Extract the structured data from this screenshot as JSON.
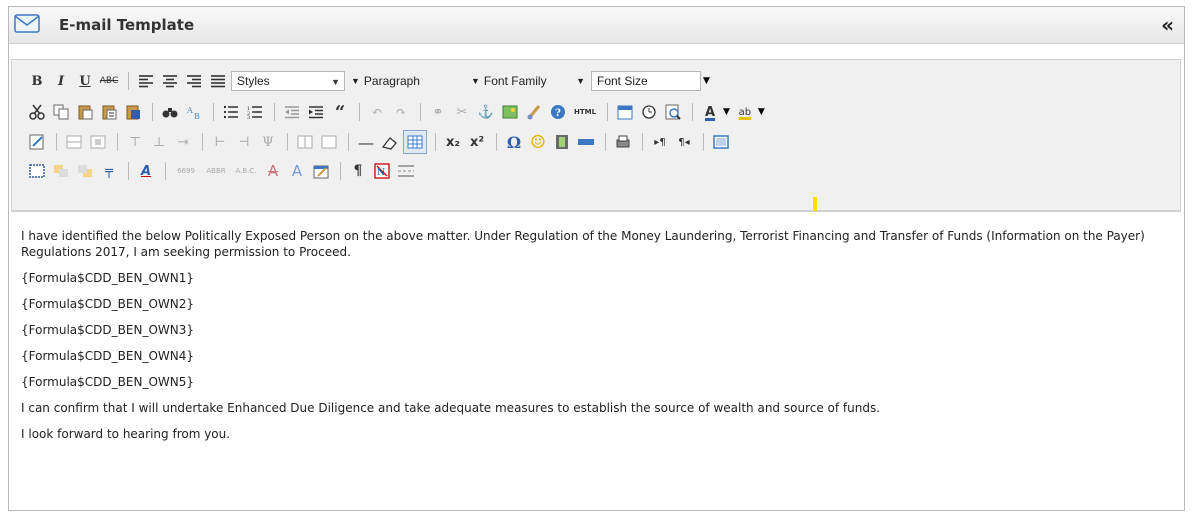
{
  "window": {
    "title": "E-mail Template",
    "collapse_label": "«"
  },
  "toolbar": {
    "styles_select": "Styles",
    "format_select": "Paragraph",
    "font_family_select": "Font Family",
    "font_size_select": "Font Size",
    "bold": "B",
    "italic": "I",
    "underline": "U",
    "strikethrough": "ABC",
    "subscript": "x₂",
    "superscript": "x²",
    "omega": "Ω",
    "paragraph_mark": "¶",
    "html_label": "HTML",
    "cite_label": "6699",
    "abbr_label": "ABBR",
    "acronym_label": "A.B.C."
  },
  "content": {
    "paragraphs": [
      "I have identified the below Politically Exposed Person on the above matter. Under Regulation of the Money Laundering, Terrorist Financing and Transfer of Funds (Information on the Payer) Regulations 2017, I am seeking permission to Proceed.",
      "{Formula$CDD_BEN_OWN1}",
      "{Formula$CDD_BEN_OWN2}",
      "{Formula$CDD_BEN_OWN3}",
      "{Formula$CDD_BEN_OWN4}",
      "{Formula$CDD_BEN_OWN5}",
      "I can confirm that I will undertake Enhanced Due Diligence and take adequate measures to establish the source of wealth and source of funds.",
      "I look forward to hearing from you."
    ]
  }
}
